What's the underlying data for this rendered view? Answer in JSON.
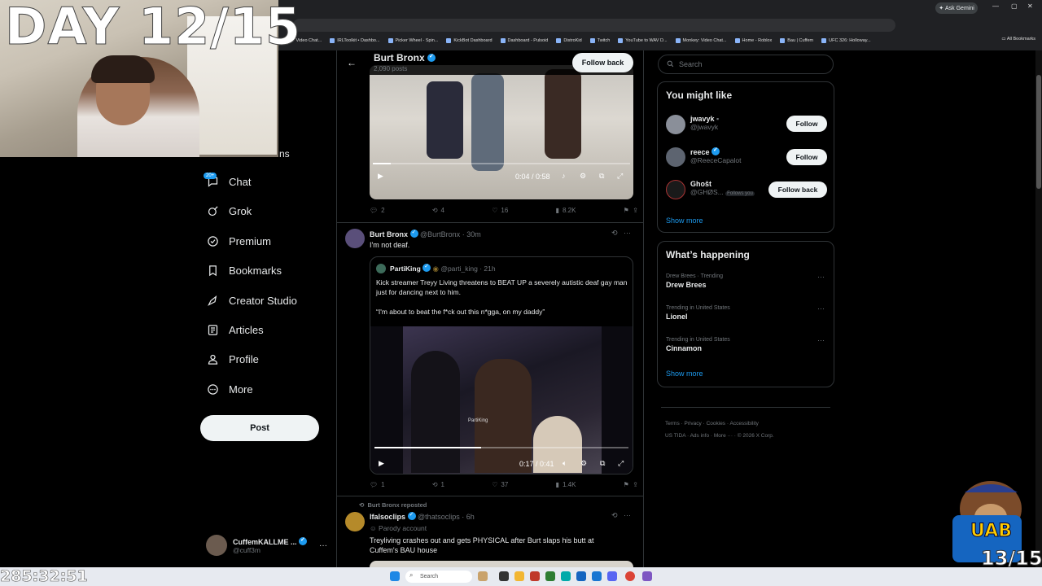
{
  "browser": {
    "ask_gemini": "Ask Gemini",
    "all_bookmarks": "All Bookmarks",
    "bookmarks": [
      "TV Video Chat...",
      "IRLToolkit • Dashbo...",
      "Picker Wheel - Spin...",
      "KickBot Dashboard",
      "Dashboard - Pulsoid",
      "DistroKid",
      "Twitch",
      "YouTube to WAV D...",
      "Monkey: Video Chat...",
      "Home - Roblox",
      "Bau | Cuffem",
      "UFC 326: Holloway..."
    ]
  },
  "stream_overlay": {
    "day_counter": "DAY 12/15",
    "timer": "285:32:51",
    "mascot_text": "13/15",
    "mascot_banner": "UAB"
  },
  "sidebar": {
    "partial_item": "ns",
    "chat_badge": "20+",
    "items": [
      {
        "label": "Chat",
        "icon": "chat-icon"
      },
      {
        "label": "Grok",
        "icon": "grok-icon"
      },
      {
        "label": "Premium",
        "icon": "premium-icon"
      },
      {
        "label": "Bookmarks",
        "icon": "bookmark-icon"
      },
      {
        "label": "Creator Studio",
        "icon": "rocket-icon"
      },
      {
        "label": "Articles",
        "icon": "article-icon"
      },
      {
        "label": "Profile",
        "icon": "profile-icon"
      },
      {
        "label": "More",
        "icon": "more-circle-icon"
      }
    ],
    "post_label": "Post",
    "account": {
      "name": "CuffemKALLME ...",
      "handle": "@cuff3m"
    }
  },
  "profile_header": {
    "name": "Burt Bronx",
    "posts": "2,090 posts",
    "follow_back": "Follow back"
  },
  "tweets": [
    {
      "video_time": "0:04 / 0:58",
      "video_progress": 0.07,
      "stats": {
        "replies": "2",
        "reposts": "4",
        "likes": "16",
        "views": "8.2K"
      }
    },
    {
      "author": "Burt Bronx",
      "handle": "@BurtBronx",
      "time": "· 30m",
      "text": "I'm not deaf.",
      "quote": {
        "author": "PartiKing",
        "handle": "@parti_king",
        "time": "· 21h",
        "text1": "Kick streamer Treyy Living threatens to BEAT UP a severely autistic deaf gay man just for dancing next to him.",
        "text2": "“I'm about to beat the f*ck out this n*gga, on my daddy”",
        "video_time": "0:17 / 0:41",
        "video_progress": 0.42,
        "watermark": "PartiKing"
      },
      "stats": {
        "replies": "1",
        "reposts": "1",
        "likes": "37",
        "views": "1.4K"
      }
    },
    {
      "repost_label": "Burt Bronx reposted",
      "author": "Ifalsoclips",
      "handle": "@thatsoclips",
      "time": "· 6h",
      "parody": "Parody account",
      "text": "Treyliving crashes out and gets PHYSICAL after Burt slaps his butt at Cuffem's BAU house"
    }
  ],
  "right": {
    "search_placeholder": "Search",
    "you_might_like": {
      "title": "You might like",
      "users": [
        {
          "name": "jwavyk",
          "handle": "@jwavyk",
          "button": "Follow",
          "follows_you": ""
        },
        {
          "name": "reece",
          "handle": "@ReeceCapalot",
          "button": "Follow",
          "follows_you": ""
        },
        {
          "name": "Ghoŝt",
          "handle": "@GHØS...",
          "button": "Follow back",
          "follows_you": "Follows you"
        }
      ],
      "show_more": "Show more"
    },
    "whats_happening": {
      "title": "What’s happening",
      "trends": [
        {
          "meta": "Drew Brees · Trending",
          "name": "Drew Brees"
        },
        {
          "meta": "Trending in United States",
          "name": "Lionel"
        },
        {
          "meta": "Trending in United States",
          "name": "Cinnamon"
        }
      ],
      "show_more": "Show more"
    },
    "footer": {
      "line1": [
        "Terms",
        "Privacy",
        "Cookies",
        "Accessibility"
      ],
      "line2": [
        "US TIDA",
        "Ads info",
        "More ···",
        "© 2026 X Corp."
      ]
    }
  },
  "taskbar": {
    "search": "Search"
  },
  "colors": {
    "accent": "#1d9bf0",
    "background": "#000000",
    "border": "#2f3336"
  }
}
